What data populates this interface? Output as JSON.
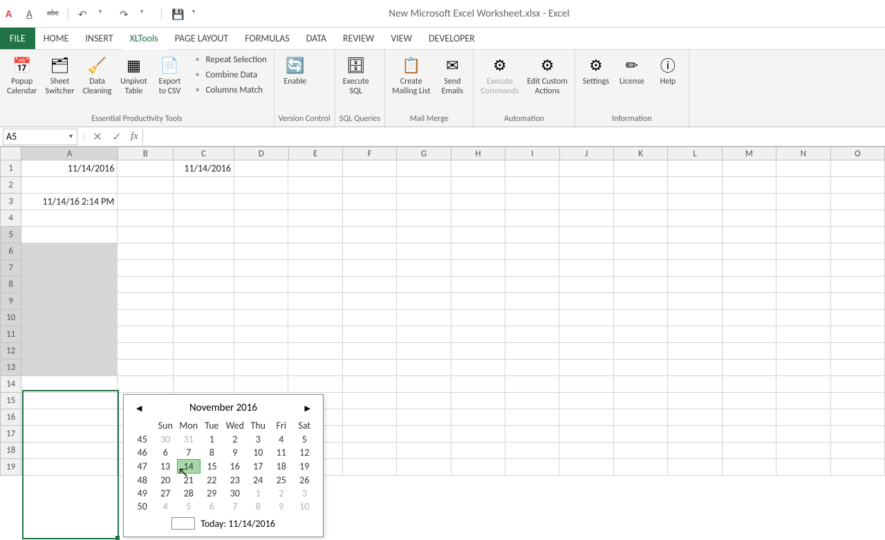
{
  "title": "New Microsoft Excel Worksheet.xlsx - Excel",
  "tabs": {
    "file": "FILE",
    "list": [
      "HOME",
      "INSERT",
      "XLTools",
      "PAGE LAYOUT",
      "FORMULAS",
      "DATA",
      "REVIEW",
      "VIEW",
      "DEVELOPER"
    ],
    "active": 2
  },
  "ribbon": {
    "g1": {
      "label": "Essential Productivity Tools",
      "btns": [
        {
          "t": "Popup\nCalendar"
        },
        {
          "t": "Sheet\nSwitcher"
        },
        {
          "t": "Data\nCleaning"
        },
        {
          "t": "Unpivot\nTable"
        },
        {
          "t": "Export\nto CSV"
        }
      ],
      "small": [
        "Repeat Selection",
        "Combine Data",
        "Columns Match"
      ]
    },
    "g2": {
      "label": "Version Control",
      "btns": [
        {
          "t": "Enable"
        }
      ]
    },
    "g3": {
      "label": "SQL Queries",
      "btns": [
        {
          "t": "Execute\nSQL"
        }
      ]
    },
    "g4": {
      "label": "Mail Merge",
      "btns": [
        {
          "t": "Create\nMailing List"
        },
        {
          "t": "Send\nEmails"
        }
      ]
    },
    "g5": {
      "label": "Automation",
      "btns": [
        {
          "t": "Execute\nCommands",
          "d": true
        },
        {
          "t": "Edit Custom\nActions"
        }
      ]
    },
    "g6": {
      "label": "Information",
      "btns": [
        {
          "t": "Settings"
        },
        {
          "t": "License"
        },
        {
          "t": "Help"
        }
      ]
    }
  },
  "namebox": "A5",
  "columns": [
    "A",
    "B",
    "C",
    "D",
    "E",
    "F",
    "G",
    "H",
    "I",
    "J",
    "K",
    "L",
    "M",
    "N",
    "O"
  ],
  "rowcount": 19,
  "cells": {
    "A1": "11/14/2016",
    "C1": "11/14/2016",
    "A3": "11/14/16 2:14 PM"
  },
  "cal": {
    "month": "November 2016",
    "days": [
      "Sun",
      "Mon",
      "Tue",
      "Wed",
      "Thu",
      "Fri",
      "Sat"
    ],
    "weeks": [
      {
        "wn": 45,
        "d": [
          {
            "n": 30,
            "g": 1
          },
          {
            "n": 31,
            "g": 1
          },
          {
            "n": 1
          },
          {
            "n": 2
          },
          {
            "n": 3
          },
          {
            "n": 4
          },
          {
            "n": 5
          }
        ]
      },
      {
        "wn": 46,
        "d": [
          {
            "n": 6
          },
          {
            "n": 7
          },
          {
            "n": 8
          },
          {
            "n": 9
          },
          {
            "n": 10
          },
          {
            "n": 11
          },
          {
            "n": 12
          }
        ]
      },
      {
        "wn": 47,
        "d": [
          {
            "n": 13
          },
          {
            "n": 14,
            "t": 1
          },
          {
            "n": 15
          },
          {
            "n": 16
          },
          {
            "n": 17
          },
          {
            "n": 18
          },
          {
            "n": 19
          }
        ]
      },
      {
        "wn": 48,
        "d": [
          {
            "n": 20
          },
          {
            "n": 21
          },
          {
            "n": 22
          },
          {
            "n": 23
          },
          {
            "n": 24
          },
          {
            "n": 25
          },
          {
            "n": 26
          }
        ]
      },
      {
        "wn": 49,
        "d": [
          {
            "n": 27
          },
          {
            "n": 28
          },
          {
            "n": 29
          },
          {
            "n": 30
          },
          {
            "n": 1,
            "g": 1
          },
          {
            "n": 2,
            "g": 1
          },
          {
            "n": 3,
            "g": 1
          }
        ]
      },
      {
        "wn": 50,
        "d": [
          {
            "n": 4,
            "g": 1
          },
          {
            "n": 5,
            "g": 1
          },
          {
            "n": 6,
            "g": 1
          },
          {
            "n": 7,
            "g": 1
          },
          {
            "n": 8,
            "g": 1
          },
          {
            "n": 9,
            "g": 1
          },
          {
            "n": 10,
            "g": 1
          }
        ]
      }
    ],
    "today": "Today: 11/14/2016"
  }
}
